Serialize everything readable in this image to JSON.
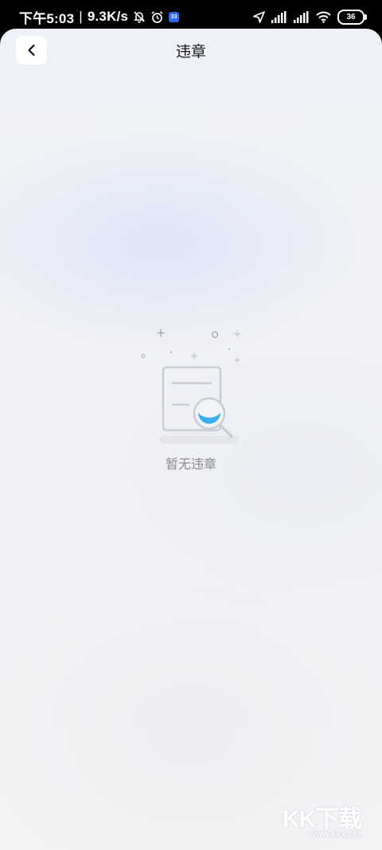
{
  "status_bar": {
    "time": "下午5:03",
    "network_speed": "9.3K/s",
    "notification_badge": "33",
    "battery_level": "36",
    "icons": [
      "mute-bell-icon",
      "alarm-icon",
      "location-arrow-icon",
      "signal-icon",
      "signal-icon",
      "wifi-icon",
      "battery-icon"
    ]
  },
  "header": {
    "title": "违章",
    "back_icon": "chevron-left-icon"
  },
  "empty_state": {
    "illustration": "document-search-icon",
    "message": "暂无违章"
  },
  "watermark": {
    "logo": "KK下载",
    "url": "www.kkx.net"
  },
  "colors": {
    "accent": "#3aaef0",
    "illustration_stroke": "#c9ccd4",
    "empty_text": "#8c8c8c"
  }
}
